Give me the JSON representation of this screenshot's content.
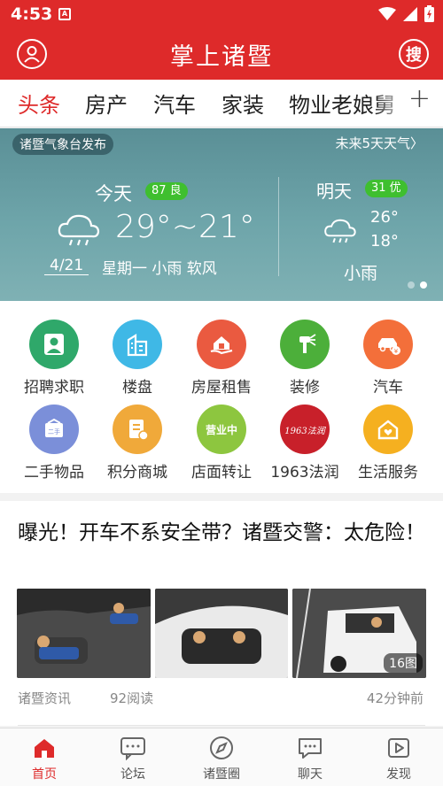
{
  "status_bar": {
    "time": "4:53",
    "app_glyph": "A"
  },
  "app_bar": {
    "title": "掌上诸暨",
    "search_label": "搜"
  },
  "tabs": [
    {
      "label": "头条",
      "active": true
    },
    {
      "label": "房产",
      "active": false
    },
    {
      "label": "汽车",
      "active": false
    },
    {
      "label": "家装",
      "active": false
    },
    {
      "label": "物业老娘舅",
      "active": false
    }
  ],
  "tabs_add": "+",
  "weather": {
    "source": "诸暨气象台发布",
    "forecast_link": "未来5天天气",
    "forecast_chevron": "〉",
    "today": {
      "label": "今天",
      "aqi": "87 良",
      "temp_range": "29°~21°",
      "date": "4/21",
      "desc": "星期一 小雨 软风"
    },
    "tomorrow": {
      "label": "明天",
      "aqi": "31 优",
      "high": "26°",
      "low": "18°",
      "desc": "小雨"
    },
    "page_count": 2,
    "active_page": 2
  },
  "services": [
    {
      "label": "招聘求职",
      "icon": "person-badge-icon",
      "color": "#2fa86a"
    },
    {
      "label": "楼盘",
      "icon": "building-icon",
      "color": "#3fb8e6"
    },
    {
      "label": "房屋租售",
      "icon": "house-hand-icon",
      "color": "#ea5a40"
    },
    {
      "label": "装修",
      "icon": "paint-spray-icon",
      "color": "#4caf3a"
    },
    {
      "label": "汽车",
      "icon": "car-icon",
      "color": "#f36f3a"
    },
    {
      "label": "二手物品",
      "icon": "secondhand-box-icon",
      "color": "#7b8fd9",
      "badge": "二手"
    },
    {
      "label": "积分商城",
      "icon": "points-mall-icon",
      "color": "#f0a93a"
    },
    {
      "label": "店面转让",
      "icon": "store-open-icon",
      "color": "#8dc63f",
      "badge": "营业中"
    },
    {
      "label": "1963法润",
      "icon": "falun-logo-icon",
      "color": "#c8202a",
      "badge": "1963法润"
    },
    {
      "label": "生活服务",
      "icon": "home-heart-icon",
      "color": "#f5b020"
    }
  ],
  "article": {
    "title": "曝光！开车不系安全带？诸暨交警：太危险！",
    "image_count": "16图",
    "source": "诸暨资讯",
    "reads": "92阅读",
    "time": "42分钟前"
  },
  "bottom_nav": [
    {
      "label": "首页",
      "icon": "home-icon",
      "active": true
    },
    {
      "label": "论坛",
      "icon": "forum-icon",
      "active": false
    },
    {
      "label": "诸暨圈",
      "icon": "compass-icon",
      "active": false
    },
    {
      "label": "聊天",
      "icon": "chat-icon",
      "active": false
    },
    {
      "label": "发现",
      "icon": "play-discover-icon",
      "active": false
    }
  ],
  "colors": {
    "brand_red": "#de2a2a",
    "aqi_green": "#3fbf2f"
  }
}
